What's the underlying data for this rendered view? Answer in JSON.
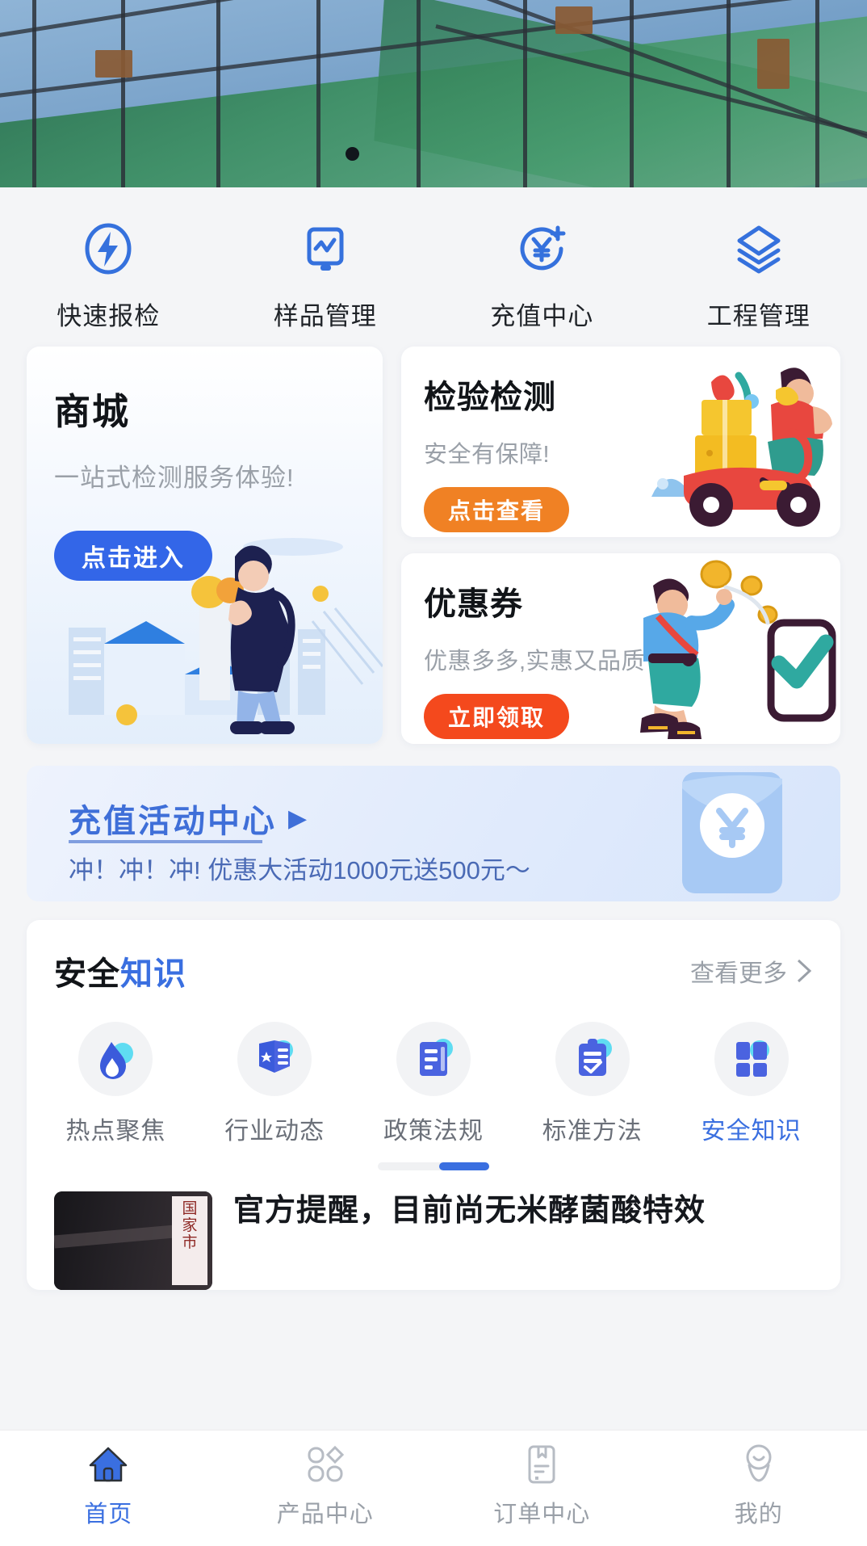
{
  "hero": {
    "name": "construction-scaffolding-banner",
    "carousel_indicator": "active-dot"
  },
  "quick_actions": [
    {
      "label": "快速报检",
      "icon": "lightning-inspection-icon"
    },
    {
      "label": "样品管理",
      "icon": "monitor-chart-icon"
    },
    {
      "label": "充值中心",
      "icon": "yuan-plus-icon"
    },
    {
      "label": "工程管理",
      "icon": "layers-stack-icon"
    }
  ],
  "promos": {
    "mall": {
      "title": "商城",
      "subtitle": "一站式检测服务体验!",
      "button": "点击进入",
      "button_color": "#3366e8",
      "illustration": "shopper-with-grocery-bag"
    },
    "inspection": {
      "title": "检验检测",
      "subtitle": "安全有保障!",
      "button": "点击查看",
      "button_color": "#f08124",
      "illustration": "scooter-delivery-rider"
    },
    "coupon": {
      "title": "优惠券",
      "subtitle": "优惠多多,实惠又品质",
      "button": "立即领取",
      "button_color": "#f4491d",
      "illustration": "man-tossing-coins-with-phone"
    }
  },
  "recharge_banner": {
    "title": "充值活动中心",
    "arrow": "▶",
    "subtitle": "冲！冲！冲!  优惠大活动1000元送500元～",
    "accent_color": "#3f6fd8",
    "illustration": "red-envelope-yuan-icon"
  },
  "knowledge": {
    "title_dark": "安全",
    "title_blue": "知识",
    "more_label": "查看更多",
    "more_icon": "chevron-right-icon",
    "categories": [
      {
        "label": "热点聚焦",
        "icon": "flame-drop-icon",
        "active": false
      },
      {
        "label": "行业动态",
        "icon": "badge-star-icon",
        "active": false
      },
      {
        "label": "政策法规",
        "icon": "document-lines-icon",
        "active": false
      },
      {
        "label": "标准方法",
        "icon": "clipboard-check-icon",
        "active": false
      },
      {
        "label": "安全知识",
        "icon": "grid-blocks-icon",
        "active": true
      }
    ],
    "news": [
      {
        "title": "官方提醒，目前尚无米酵菌酸特效",
        "thumbnail": "government-market-regulation-sign",
        "thumbnail_text": [
          "国",
          "家",
          "市"
        ]
      }
    ]
  },
  "tabbar": [
    {
      "label": "首页",
      "icon": "home-icon",
      "active": true
    },
    {
      "label": "产品中心",
      "icon": "grid-products-icon",
      "active": false
    },
    {
      "label": "订单中心",
      "icon": "order-document-icon",
      "active": false
    },
    {
      "label": "我的",
      "icon": "user-profile-icon",
      "active": false
    }
  ],
  "theme": {
    "primary": "#3a6fe0",
    "page_bg": "#f4f5f7",
    "card_bg": "#ffffff",
    "muted_text": "#9aa0a8"
  }
}
